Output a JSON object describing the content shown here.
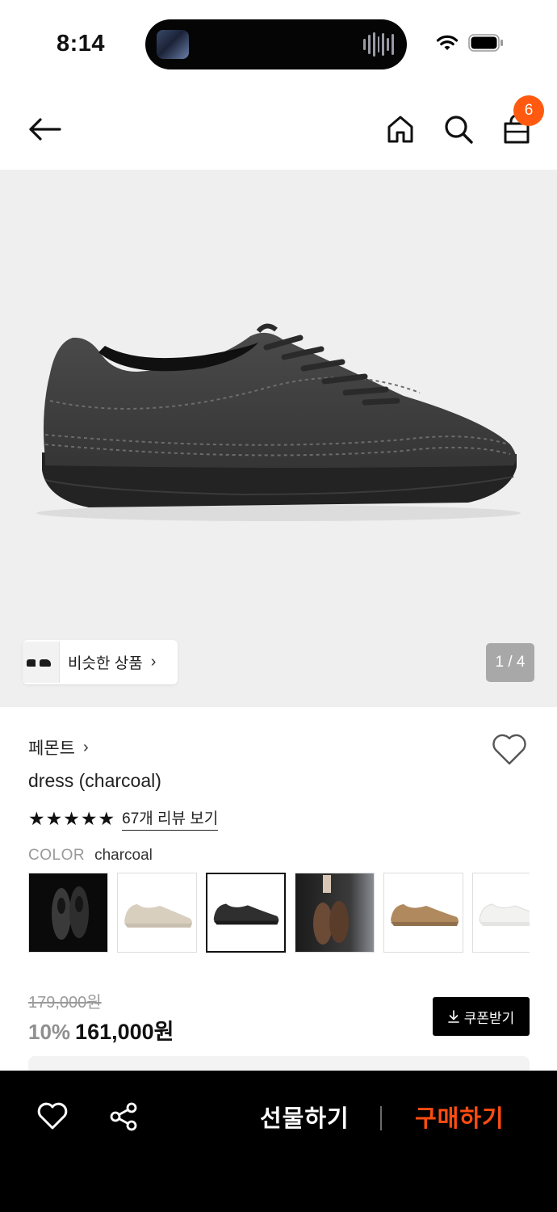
{
  "status_bar": {
    "time": "8:14"
  },
  "nav": {
    "cart_count": "6"
  },
  "hero": {
    "similar_products_label": "비슷한 상품",
    "chevron": "›",
    "page_indicator": "1 / 4"
  },
  "product": {
    "brand": "페몬트",
    "brand_chevron": "›",
    "title": "dress (charcoal)",
    "rating": 5,
    "review_link": "67개 리뷰 보기",
    "color_key": "COLOR",
    "color_value": "charcoal",
    "swatches": [
      {
        "name": "black-pair"
      },
      {
        "name": "beige"
      },
      {
        "name": "charcoal"
      },
      {
        "name": "brown-lifestyle"
      },
      {
        "name": "tan"
      },
      {
        "name": "white"
      }
    ],
    "selected_swatch": 2
  },
  "price": {
    "original": "179,000원",
    "discount": "10%",
    "current": "161,000원",
    "coupon_label": "쿠폰받기"
  },
  "bottom_bar": {
    "gift_label": "선물하기",
    "buy_label": "구매하기"
  },
  "colors": {
    "accent": "#ff5a0f",
    "buy": "#ff4d10",
    "hero_bg": "#efefef"
  },
  "icons": [
    "back-arrow-icon",
    "home-icon",
    "search-icon",
    "shopping-bag-icon",
    "heart-icon",
    "share-icon",
    "download-icon",
    "chevron-right-icon",
    "star-icon"
  ]
}
